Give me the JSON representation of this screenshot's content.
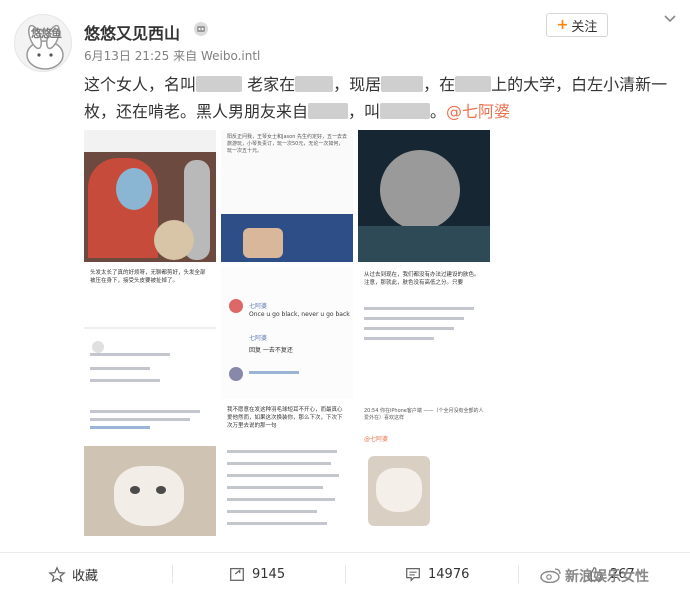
{
  "post": {
    "username": "悠悠又见西山",
    "date": "6月13日 21:25",
    "source": "来自 Weibo.intl",
    "follow_label": "关注",
    "avatar_text": "悠悠鱼",
    "text": {
      "p1": "这个女人，名叫",
      "p2": "老家在",
      "p3": "，现居",
      "p4": "，在",
      "p5": "上的大学，白左小清新一枚，还在啃老。黑人男朋友来自",
      "p6": "，叫",
      "p7": "。",
      "mention": "@七阿婆"
    }
  },
  "images": {
    "img2_caption": "阳反正问我，王琴女士和Jason 先生约定好，五一去去旅游玩，小琴负责订，玩一次50元，无论一次如何，玩一次五十元。",
    "img4_text": "头发太长了真的好烦呀，无聊都剪好，头发全部被压在身下，接受头皮要被扯掉了。",
    "img5_user": "七阿婆",
    "img5_msg": "Once u go black, never u go back",
    "img5_reply": "回复 一去不复还",
    "img5_user2": "七阿婆",
    "img6_text": "从过去到现在，我们都没有办法过建设的肤色。注意，那就此，肤色没有高低之分。只要",
    "img8_text": "我不愿意在发这种羽毛球短耳不开心，而最真心爱他然而，如果这次换装你，那么下次，下次下次万里去说的那一句",
    "img9_text": "20:54 你在iPhone客户端 ——（个全月没有全部的人爱外在）喜欢这样",
    "img9_mention": "@七阿婆"
  },
  "actions": {
    "favorite": "收藏",
    "repost_count": "9145",
    "comment_count": "14976",
    "like_count": "267"
  },
  "watermark": "新浪娱乐女性"
}
